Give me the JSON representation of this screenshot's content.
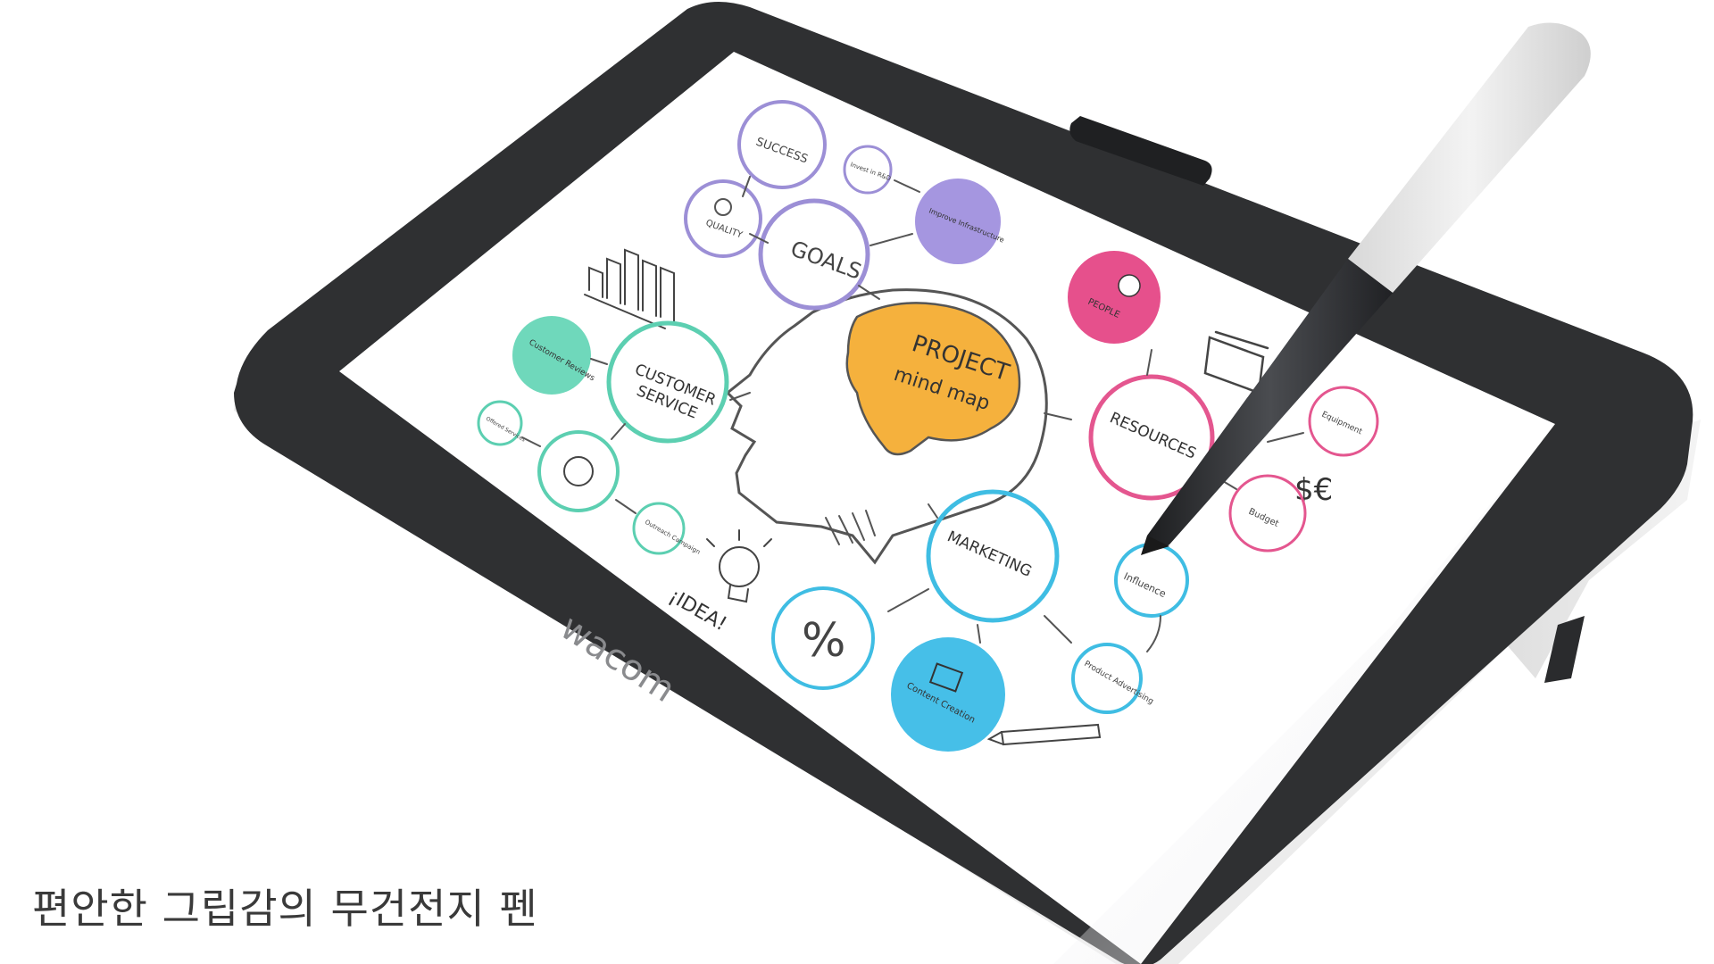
{
  "caption": "편안한 그립감의 무건전지 펜",
  "tablet": {
    "brand": "wacom"
  },
  "mind_map": {
    "center": [
      "PROJECT",
      "mind map"
    ],
    "nodes": {
      "success": "SUCCESS",
      "invest": "Invest in R&D",
      "quality": "QUALITY",
      "goals": "GOALS",
      "improve": "Improve Infrastructure",
      "customer_reviews": "Customer Reviews",
      "customer_service": [
        "CUSTOMER",
        "SERVICE"
      ],
      "offered_services": "Offered Services",
      "outreach": "Outreach Campaign",
      "idea": "¡IDEA!",
      "people": "PEOPLE",
      "resources": "RESOURCES",
      "equipment": "Equipment",
      "money": "$€",
      "budget": "Budget",
      "marketing": "MARKETING",
      "percent": "%",
      "content_creation": "Content Creation",
      "product_advertising": "Product Advertising",
      "influence": "Influence"
    }
  },
  "colors": {
    "bezel": "#2f3032",
    "screen": "#ffffff",
    "purple": "#9c8fd6",
    "purple_fill": "#a596e0",
    "teal": "#5ccfb1",
    "teal_fill": "#6fd8bb",
    "blue": "#3fbde3",
    "blue_fill": "#46bfe8",
    "pink": "#e4568f",
    "pink_fill": "#e6508c",
    "orange": "#f5b13d"
  }
}
